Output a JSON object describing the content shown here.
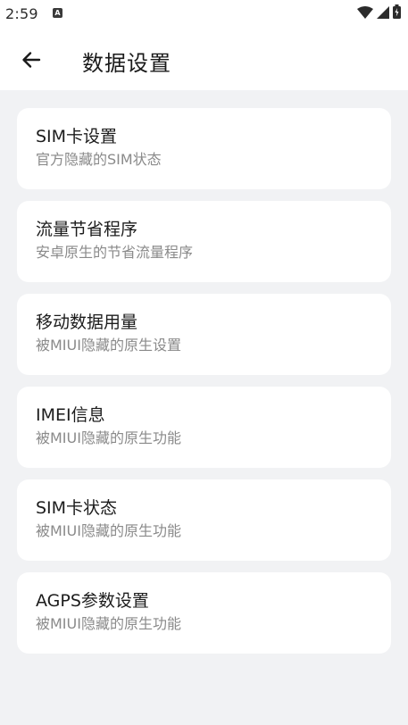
{
  "status_bar": {
    "time": "2:59",
    "notification_icon": "a-square-icon",
    "notification_letter": "A",
    "icons": [
      "wifi-icon",
      "cellular-signal-icon",
      "battery-icon"
    ]
  },
  "header": {
    "back_icon": "arrow-left-icon",
    "title": "数据设置"
  },
  "items": [
    {
      "title": "SIM卡设置",
      "subtitle": "官方隐藏的SIM状态"
    },
    {
      "title": "流量节省程序",
      "subtitle": "安卓原生的节省流量程序"
    },
    {
      "title": "移动数据用量",
      "subtitle": "被MIUI隐藏的原生设置"
    },
    {
      "title": "IMEI信息",
      "subtitle": "被MIUI隐藏的原生功能"
    },
    {
      "title": "SIM卡状态",
      "subtitle": "被MIUI隐藏的原生功能"
    },
    {
      "title": "AGPS参数设置",
      "subtitle": "被MIUI隐藏的原生功能"
    }
  ],
  "colors": {
    "background": "#f1f2f4",
    "card": "#ffffff",
    "title_text": "#1c1c1c",
    "subtitle_text": "#8a8a8a"
  }
}
